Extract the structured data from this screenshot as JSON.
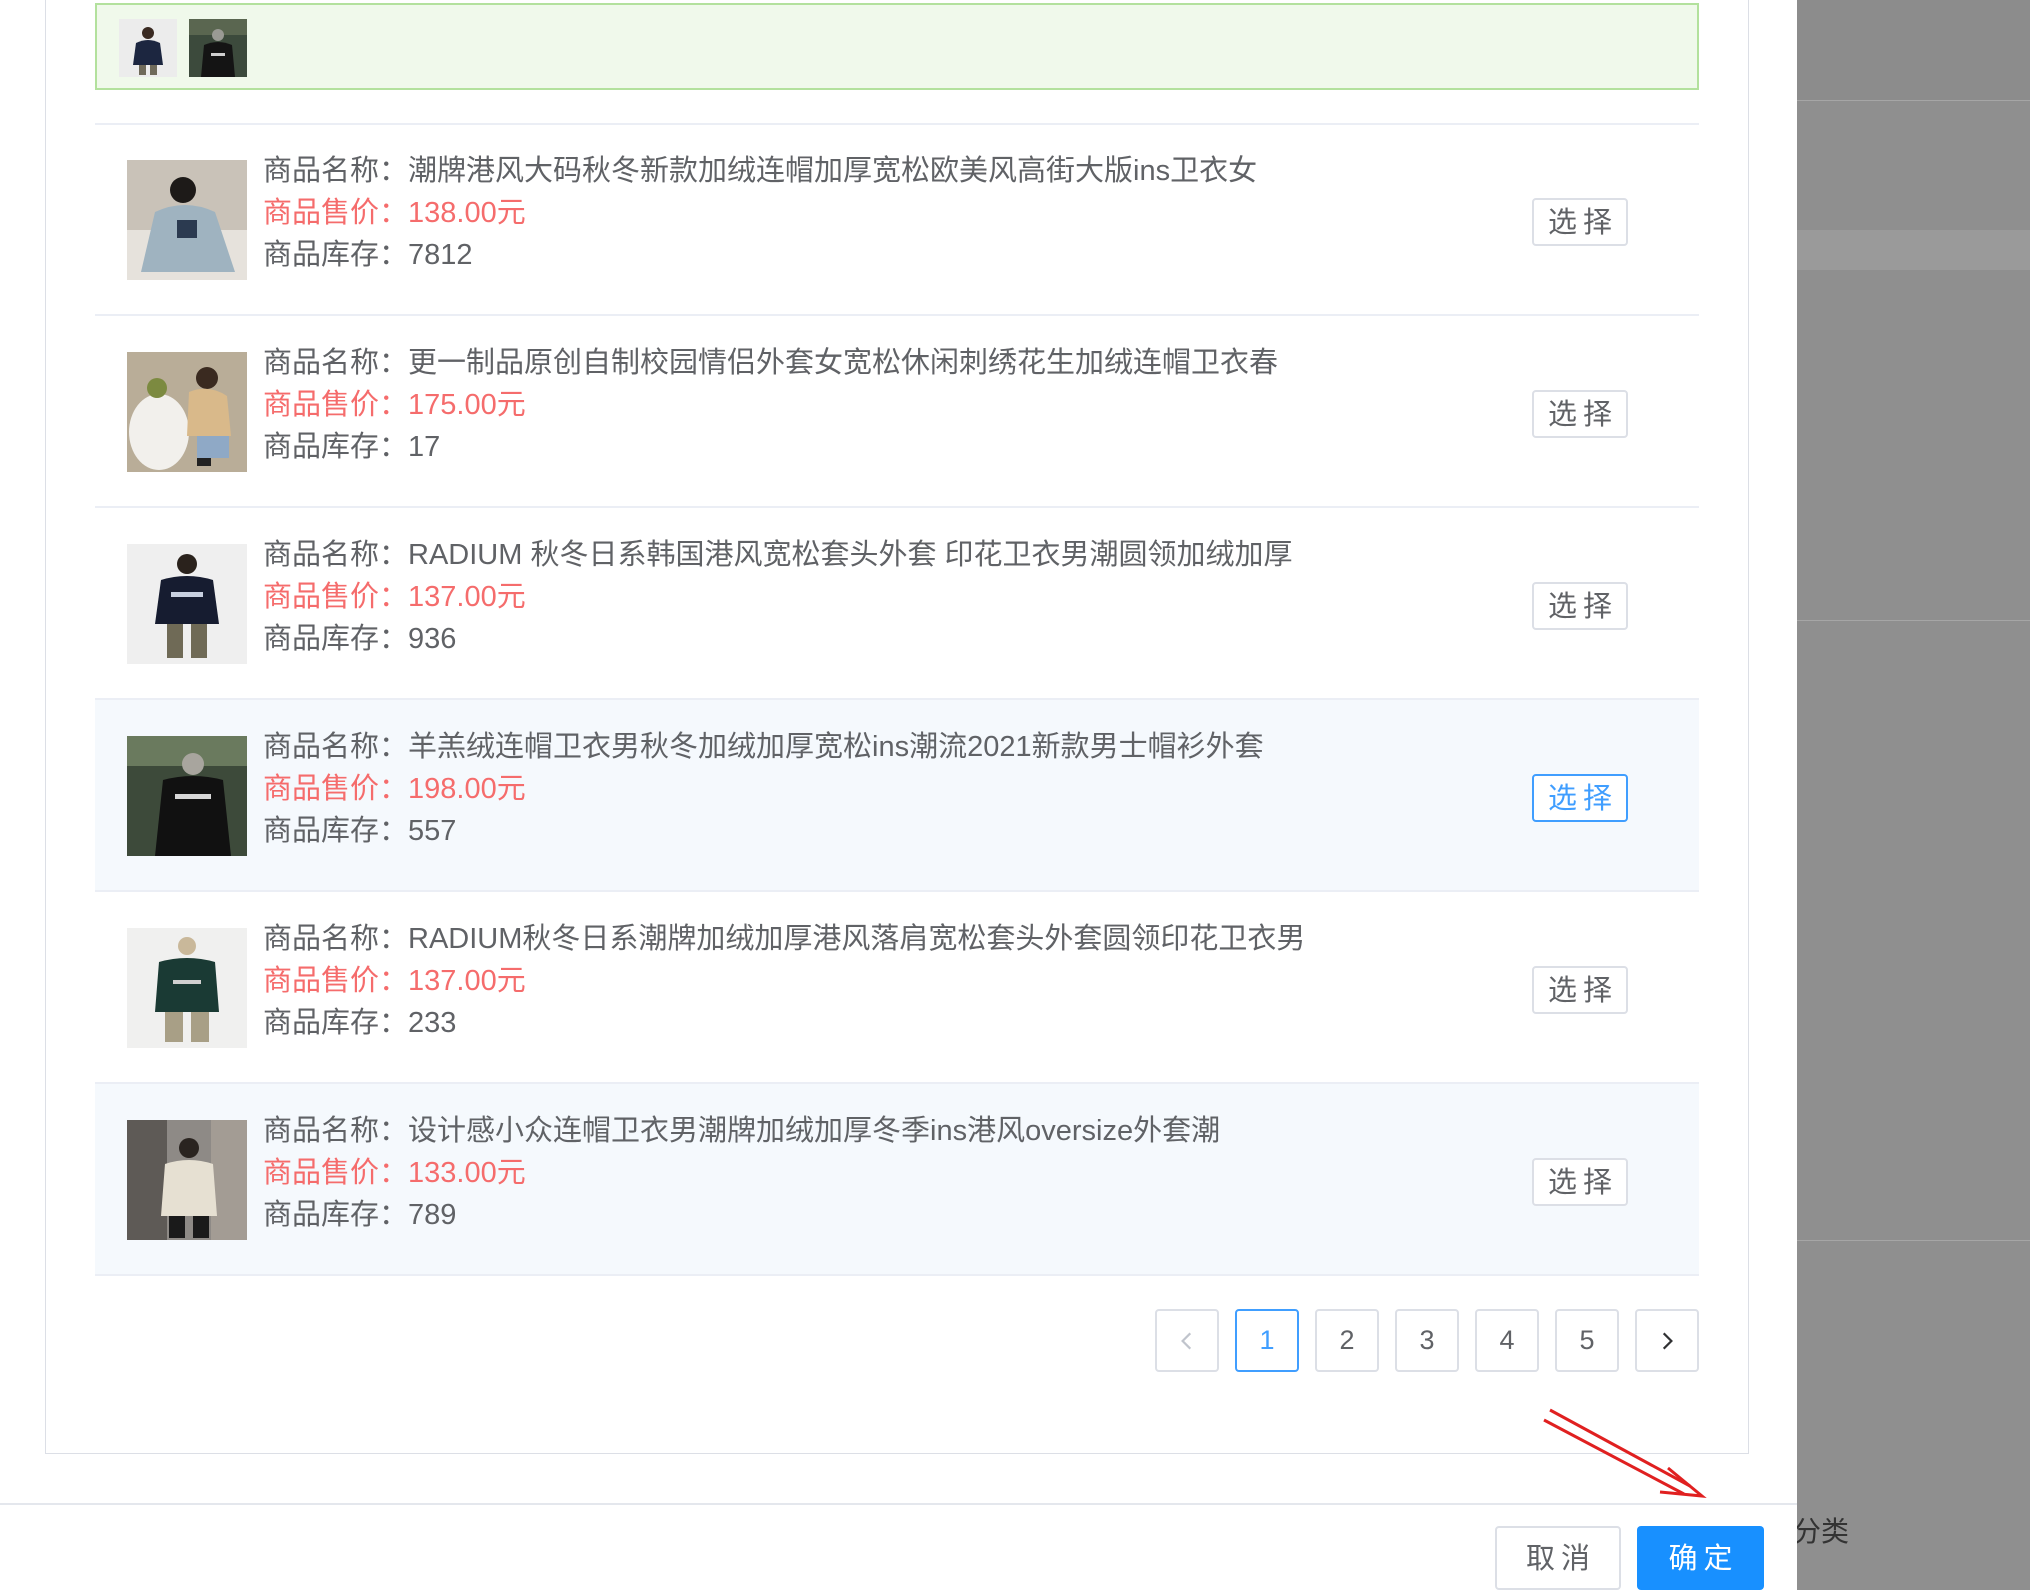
{
  "background_page": {
    "partial_label": "分类"
  },
  "selected": {
    "thumb_icons": [
      "product-thumb-icon",
      "product-thumb-icon"
    ]
  },
  "labels": {
    "name": "商品名称：",
    "price": "商品售价：",
    "stock": "商品库存："
  },
  "products": [
    {
      "name": "潮牌港风大码秋冬新款加绒连帽加厚宽松欧美风高街大版ins卫衣女",
      "price": "138.00元",
      "stock": "7812",
      "select_label": "选择"
    },
    {
      "name": "更一制品原创自制校园情侣外套女宽松休闲刺绣花生加绒连帽卫衣春",
      "price": "175.00元",
      "stock": "17",
      "select_label": "选择"
    },
    {
      "name": "RADIUM 秋冬日系韩国港风宽松套头外套 印花卫衣男潮圆领加绒加厚",
      "price": "137.00元",
      "stock": "936",
      "select_label": "选择"
    },
    {
      "name": "羊羔绒连帽卫衣男秋冬加绒加厚宽松ins潮流2021新款男士帽衫外套",
      "price": "198.00元",
      "stock": "557",
      "select_label": "选择"
    },
    {
      "name": "RADIUM秋冬日系潮牌加绒加厚港风落肩宽松套头外套圆领印花卫衣男",
      "price": "137.00元",
      "stock": "233",
      "select_label": "选择"
    },
    {
      "name": "设计感小众连帽卫衣男潮牌加绒加厚冬季ins港风oversize外套潮",
      "price": "133.00元",
      "stock": "789",
      "select_label": "选择"
    }
  ],
  "pagination": {
    "pages": [
      "1",
      "2",
      "3",
      "4",
      "5"
    ],
    "current": "1",
    "prev_icon": "chevron-left-icon",
    "next_icon": "chevron-right-icon"
  },
  "footer": {
    "cancel_label": "取消",
    "ok_label": "确定"
  },
  "colors": {
    "price": "#f56c6c",
    "primary": "#1890ff",
    "active_border": "#409eff",
    "selected_strip_bg": "#f0f9eb",
    "annotation_arrow": "#e02020"
  }
}
